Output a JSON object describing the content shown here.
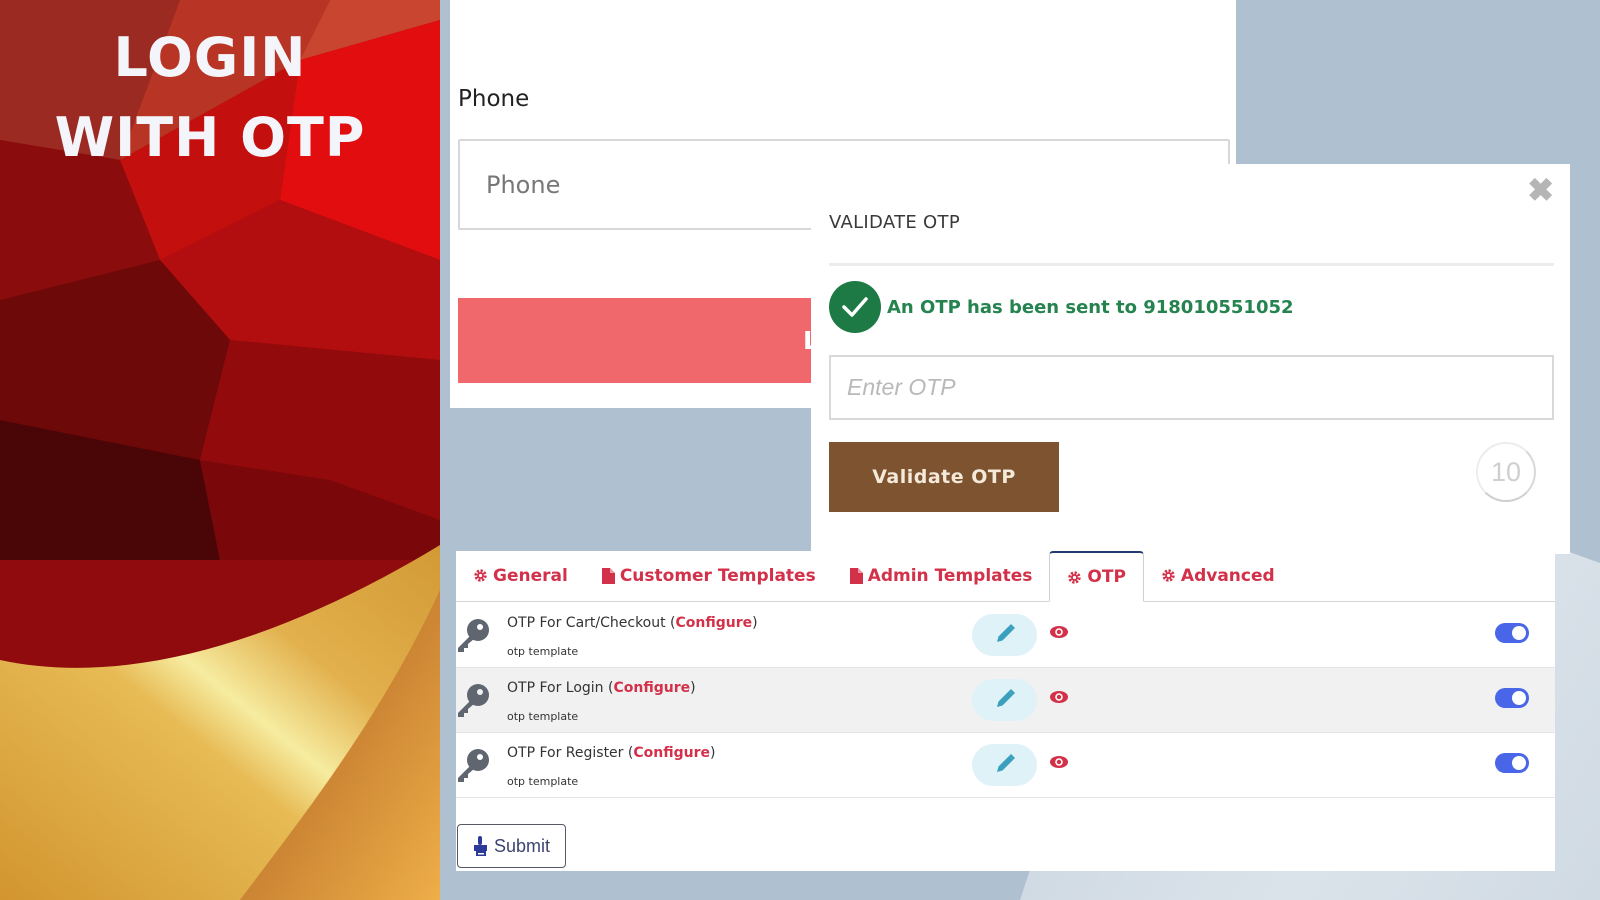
{
  "banner": {
    "title_line1": "LOGIN",
    "title_line2": "WITH OTP"
  },
  "login": {
    "phone_label": "Phone",
    "phone_placeholder": "Phone",
    "phone_value": "",
    "login_button": "LOGIN"
  },
  "otp_modal": {
    "title": "VALIDATE OTP",
    "close_icon": "close-icon",
    "sent_message": "An OTP has been sent to 918010551052",
    "otp_placeholder": "Enter OTP",
    "otp_value": "",
    "validate_button": "Validate OTP",
    "countdown": "10"
  },
  "settings": {
    "tabs": [
      {
        "label": "General",
        "icon": "gear-icon",
        "active": false
      },
      {
        "label": "Customer Templates",
        "icon": "file-icon",
        "active": false
      },
      {
        "label": "Admin Templates",
        "icon": "file-icon",
        "active": false
      },
      {
        "label": "OTP",
        "icon": "gear-icon",
        "active": true
      },
      {
        "label": "Advanced",
        "icon": "gear-icon",
        "active": false
      }
    ],
    "rows": [
      {
        "title": "OTP For Cart/Checkout",
        "configure": "Configure",
        "subtitle": "otp template",
        "enabled": true
      },
      {
        "title": "OTP For Login",
        "configure": "Configure",
        "subtitle": "otp template",
        "enabled": true
      },
      {
        "title": "OTP For Register",
        "configure": "Configure",
        "subtitle": "otp template",
        "enabled": true
      }
    ],
    "submit_label": "Submit"
  },
  "colors": {
    "login_button": "#f0686c",
    "validate_button": "#7d5330",
    "success_green": "#1d7a45",
    "tab_accent": "#d33049",
    "toggle_on": "#4a66e8",
    "page_background": "#afc0d1"
  }
}
